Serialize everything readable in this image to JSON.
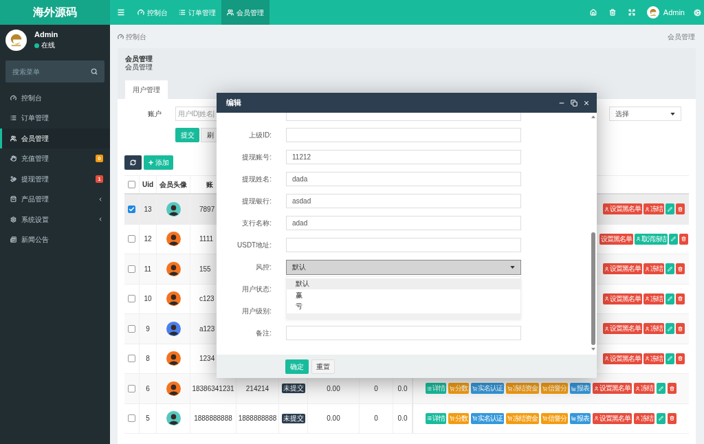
{
  "brand": {
    "title": "海外源码"
  },
  "top_nav": {
    "tabs": [
      {
        "label": "控制台",
        "selected": false
      },
      {
        "label": "订单管理",
        "selected": false
      },
      {
        "label": "会员管理",
        "selected": true
      }
    ],
    "user": {
      "name": "Admin"
    }
  },
  "sidebar": {
    "user": {
      "name": "Admin",
      "status": "在线",
      "online": true
    },
    "search": {
      "placeholder": "搜索菜单"
    },
    "items": [
      {
        "label": "控制台",
        "selected": false,
        "submenu": false
      },
      {
        "label": "订单管理",
        "selected": false,
        "submenu": false
      },
      {
        "label": "会员管理",
        "selected": true,
        "submenu": false
      },
      {
        "label": "充值管理",
        "selected": false,
        "submenu": false,
        "badge": {
          "text": "0",
          "color": "#f39c12"
        }
      },
      {
        "label": "提现管理",
        "selected": false,
        "submenu": false,
        "badge": {
          "text": "1",
          "color": "#e74c3c"
        }
      },
      {
        "label": "产品管理",
        "selected": false,
        "submenu": true
      },
      {
        "label": "系统设置",
        "selected": false,
        "submenu": true
      },
      {
        "label": "新闻公告",
        "selected": false,
        "submenu": false
      }
    ]
  },
  "breadcrumb": {
    "home": "控制台",
    "current": "会员管理"
  },
  "panel": {
    "title": "会员管理",
    "subtitle": "会员管理",
    "tabs": [
      {
        "label": "用户管理",
        "selected": true
      }
    ]
  },
  "filters": {
    "account": {
      "label": "账户",
      "placeholder": "用户ID|姓名|"
    },
    "select": {
      "value": "选择"
    },
    "buttons": [
      {
        "kind": "primary",
        "label": "提交"
      },
      {
        "kind": "default",
        "label": "刷"
      }
    ]
  },
  "toolbar": {
    "add_label": "添加"
  },
  "table": {
    "header": {
      "checked": false,
      "columns": [
        "Uid",
        "会员头像",
        "账"
      ]
    },
    "rows": [
      {
        "kind": "covered",
        "checked": true,
        "uid": "13",
        "avatar": {
          "color": "#55c8c0"
        },
        "column_4": "7897",
        "actions": [
          {
            "kind": "blacklist",
            "label": "设置黑名单",
            "color": "#e74c3c"
          },
          {
            "kind": "freeze",
            "label": "冻结",
            "color": "#e74c3c"
          },
          {
            "kind": "edit",
            "color": "#18bc9c"
          },
          {
            "kind": "delete",
            "color": "#e74c3c"
          }
        ]
      },
      {
        "kind": "covered",
        "checked": false,
        "uid": "12",
        "avatar": {
          "color": "#f4731f"
        },
        "column_4": "1111",
        "actions": [
          {
            "kind": "blacklist",
            "label": "设置黑名单",
            "color": "#e74c3c",
            "icon": false
          },
          {
            "kind": "unfreeze",
            "label": "取消冻结",
            "color": "#18bc9c"
          },
          {
            "kind": "edit",
            "color": "#18bc9c"
          },
          {
            "kind": "delete",
            "color": "#e74c3c"
          }
        ]
      },
      {
        "kind": "covered",
        "checked": false,
        "uid": "11",
        "avatar": {
          "color": "#f4731f"
        },
        "column_4": "155",
        "actions": [
          {
            "kind": "blacklist",
            "label": "设置黑名单",
            "color": "#e74c3c"
          },
          {
            "kind": "freeze",
            "label": "冻结",
            "color": "#e74c3c"
          },
          {
            "kind": "edit",
            "color": "#18bc9c"
          },
          {
            "kind": "delete",
            "color": "#e74c3c"
          }
        ]
      },
      {
        "kind": "covered",
        "checked": false,
        "uid": "10",
        "avatar": {
          "color": "#f4731f"
        },
        "column_4": "c123",
        "actions": [
          {
            "kind": "blacklist",
            "label": "设置黑名单",
            "color": "#e74c3c"
          },
          {
            "kind": "freeze",
            "label": "冻结",
            "color": "#e74c3c"
          },
          {
            "kind": "edit",
            "color": "#18bc9c"
          },
          {
            "kind": "delete",
            "color": "#e74c3c"
          }
        ]
      },
      {
        "kind": "covered",
        "checked": false,
        "uid": "9",
        "avatar": {
          "color": "#4a80ee"
        },
        "column_4": "a123",
        "actions": [
          {
            "kind": "blacklist",
            "label": "设置黑名单",
            "color": "#e74c3c"
          },
          {
            "kind": "freeze",
            "label": "冻结",
            "color": "#e74c3c"
          },
          {
            "kind": "edit",
            "color": "#18bc9c"
          },
          {
            "kind": "delete",
            "color": "#e74c3c"
          }
        ]
      },
      {
        "kind": "covered",
        "checked": false,
        "uid": "8",
        "avatar": {
          "color": "#f4731f"
        },
        "column_4": "1234",
        "actions": [
          {
            "kind": "blacklist",
            "label": "设置黑名单",
            "color": "#e74c3c"
          },
          {
            "kind": "freeze",
            "label": "冻结",
            "color": "#e74c3c"
          },
          {
            "kind": "edit",
            "color": "#18bc9c"
          },
          {
            "kind": "delete",
            "color": "#e74c3c"
          }
        ]
      },
      {
        "kind": "full",
        "checked": false,
        "uid": "6",
        "avatar": {
          "color": "#f4731f"
        },
        "column_4": "18386341231",
        "column_5": "214214",
        "column_6": "未提交",
        "column_7": "0.00",
        "column_8": "0",
        "column_9": "0.0",
        "actions": [
          {
            "kind": "details",
            "label": "详情",
            "color": "#18bc9c"
          },
          {
            "kind": "score",
            "label": "分数",
            "color": "#f39c12"
          },
          {
            "kind": "verify",
            "label": "实名认证",
            "color": "#3498db"
          },
          {
            "kind": "funds",
            "label": "冻结资金",
            "color": "#f39c12"
          },
          {
            "kind": "credit",
            "label": "信誉分",
            "color": "#f39c12"
          },
          {
            "kind": "report",
            "label": "报表",
            "color": "#3498db"
          },
          {
            "kind": "blacklist",
            "label": "设置黑名单",
            "color": "#e74c3c"
          },
          {
            "kind": "freeze",
            "label": "冻结",
            "color": "#e74c3c"
          },
          {
            "kind": "edit",
            "color": "#18bc9c"
          },
          {
            "kind": "delete",
            "color": "#e74c3c"
          }
        ]
      },
      {
        "kind": "full",
        "checked": false,
        "uid": "5",
        "avatar": {
          "color": "#55c8c0"
        },
        "column_4": "1888888888",
        "column_5": "1888888888",
        "column_6": "未提交",
        "column_7": "0.00",
        "column_8": "0",
        "column_9": "0.0",
        "actions": [
          {
            "kind": "details",
            "label": "详情",
            "color": "#18bc9c"
          },
          {
            "kind": "score",
            "label": "分数",
            "color": "#f39c12"
          },
          {
            "kind": "verify",
            "label": "实名认证",
            "color": "#3498db"
          },
          {
            "kind": "funds",
            "label": "冻结资金",
            "color": "#f39c12"
          },
          {
            "kind": "credit",
            "label": "信誉分",
            "color": "#f39c12"
          },
          {
            "kind": "report",
            "label": "报表",
            "color": "#3498db"
          },
          {
            "kind": "blacklist",
            "label": "设置黑名单",
            "color": "#e74c3c"
          },
          {
            "kind": "freeze",
            "label": "冻结",
            "color": "#e74c3c"
          },
          {
            "kind": "edit",
            "color": "#18bc9c"
          },
          {
            "kind": "delete",
            "color": "#e74c3c"
          }
        ]
      }
    ]
  },
  "dialog": {
    "title": "编辑",
    "fields": [
      {
        "kind": "partial"
      },
      {
        "kind": "input",
        "label": "上级ID:"
      },
      {
        "kind": "input",
        "label": "提现账号:",
        "value": "11212"
      },
      {
        "kind": "input",
        "label": "提现姓名:",
        "value": "dada"
      },
      {
        "kind": "input",
        "label": "提现银行:",
        "value": "asdad"
      },
      {
        "kind": "input",
        "label": "支行名称:",
        "value": "adad"
      },
      {
        "kind": "input",
        "label": "USDT地址:"
      },
      {
        "kind": "select",
        "label": "风控:",
        "value": "默认",
        "open": true,
        "options": [
          {
            "label": "默认",
            "selected": true
          },
          {
            "label": "赢",
            "selected": false
          },
          {
            "label": "亏",
            "selected": false
          }
        ]
      },
      {
        "kind": "hidden",
        "label": "用户状态:"
      },
      {
        "kind": "hidden",
        "label": "用户级别:"
      },
      {
        "kind": "input",
        "label": "备注:"
      }
    ],
    "buttons": [
      {
        "kind": "primary",
        "label": "确定"
      },
      {
        "kind": "default",
        "label": "重置"
      }
    ]
  }
}
